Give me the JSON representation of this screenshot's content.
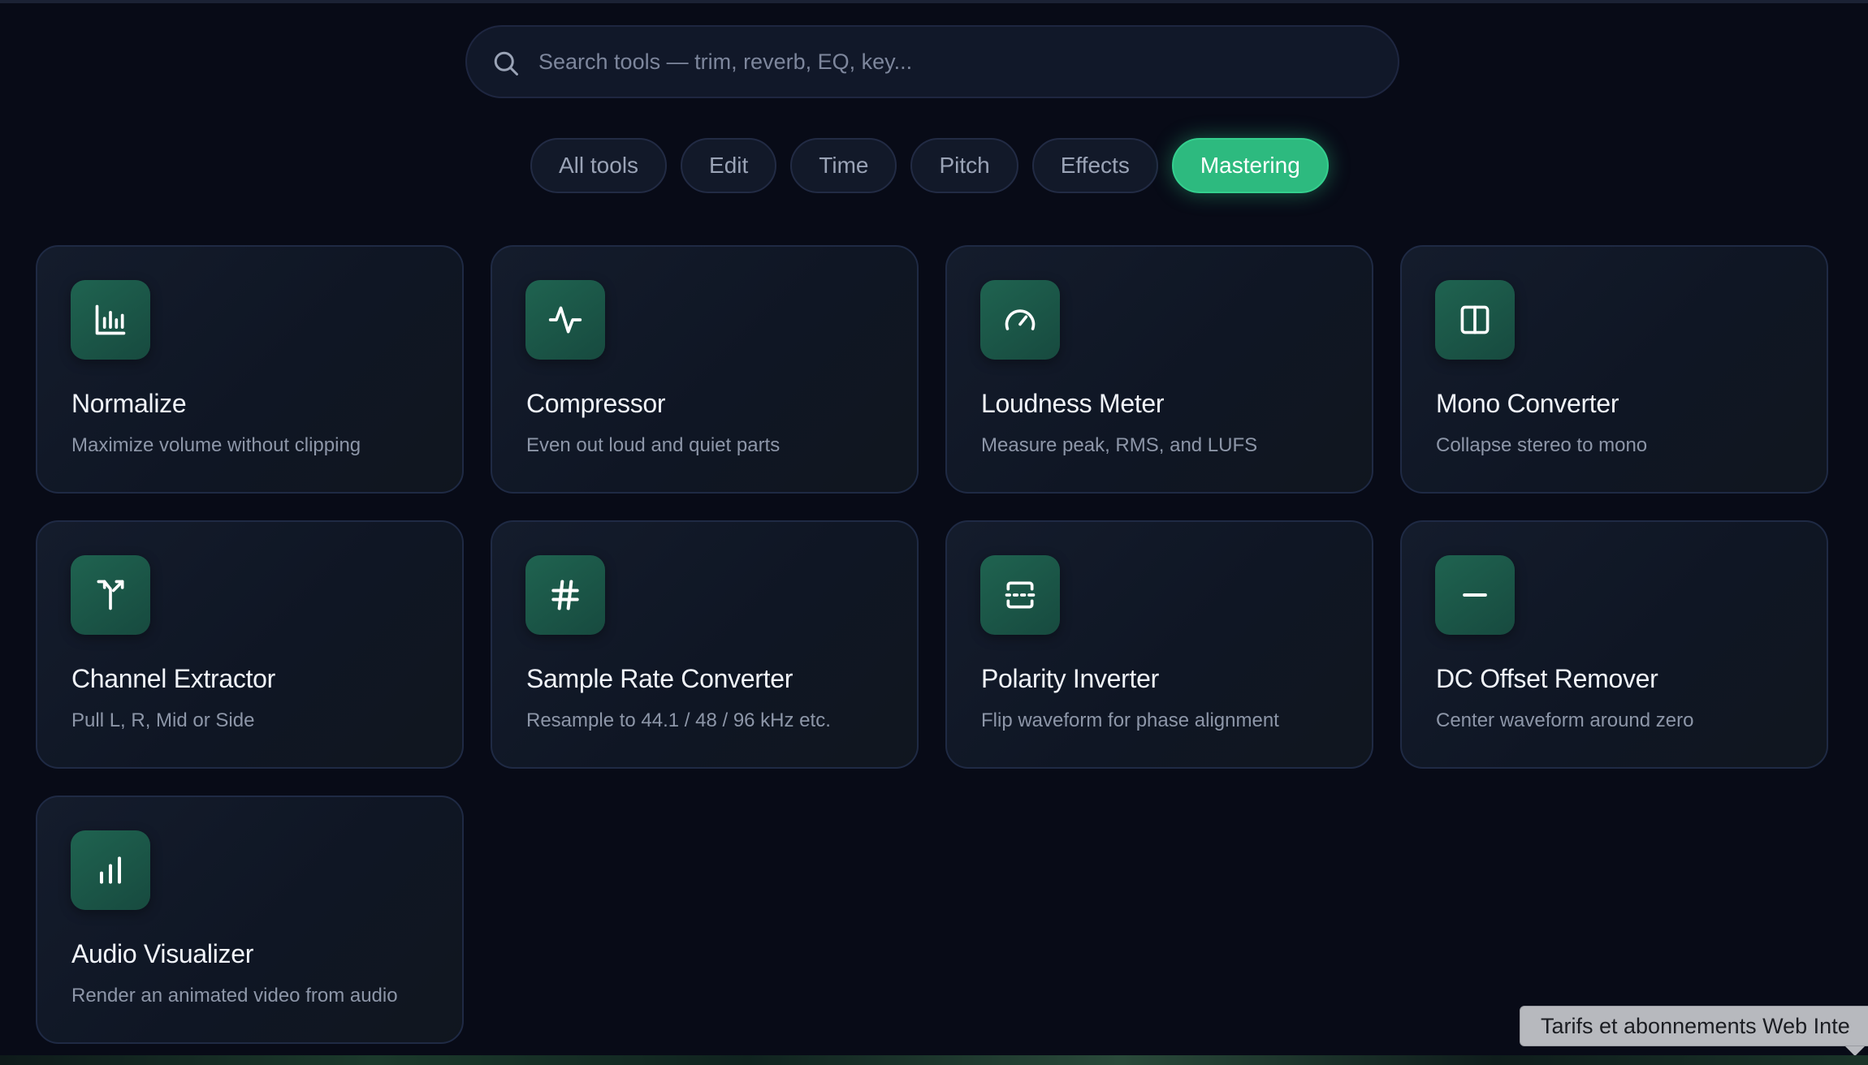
{
  "search": {
    "placeholder": "Search tools — trim, reverb, EQ, key...",
    "value": ""
  },
  "filters": [
    {
      "label": "All tools",
      "active": false
    },
    {
      "label": "Edit",
      "active": false
    },
    {
      "label": "Time",
      "active": false
    },
    {
      "label": "Pitch",
      "active": false
    },
    {
      "label": "Effects",
      "active": false
    },
    {
      "label": "Mastering",
      "active": true
    }
  ],
  "tools": [
    {
      "title": "Normalize",
      "description": "Maximize volume without clipping",
      "icon": "bar-chart-icon"
    },
    {
      "title": "Compressor",
      "description": "Even out loud and quiet parts",
      "icon": "pulse-icon"
    },
    {
      "title": "Loudness Meter",
      "description": "Measure peak, RMS, and LUFS",
      "icon": "gauge-icon"
    },
    {
      "title": "Mono Converter",
      "description": "Collapse stereo to mono",
      "icon": "split-panel-icon"
    },
    {
      "title": "Channel Extractor",
      "description": "Pull L, R, Mid or Side",
      "icon": "fork-arrows-icon"
    },
    {
      "title": "Sample Rate Converter",
      "description": "Resample to 44.1 / 48 / 96 kHz etc.",
      "icon": "hash-icon"
    },
    {
      "title": "Polarity Inverter",
      "description": "Flip waveform for phase alignment",
      "icon": "flip-icon"
    },
    {
      "title": "DC Offset Remover",
      "description": "Center waveform around zero",
      "icon": "minus-icon"
    },
    {
      "title": "Audio Visualizer",
      "description": "Render an animated video from audio",
      "icon": "signal-bars-icon"
    }
  ],
  "tooltip": {
    "text": "Tarifs et abonnements Web Inte"
  },
  "colors": {
    "background": "#080b17",
    "accent": "#2dba7f",
    "tile": "#1f6350"
  }
}
